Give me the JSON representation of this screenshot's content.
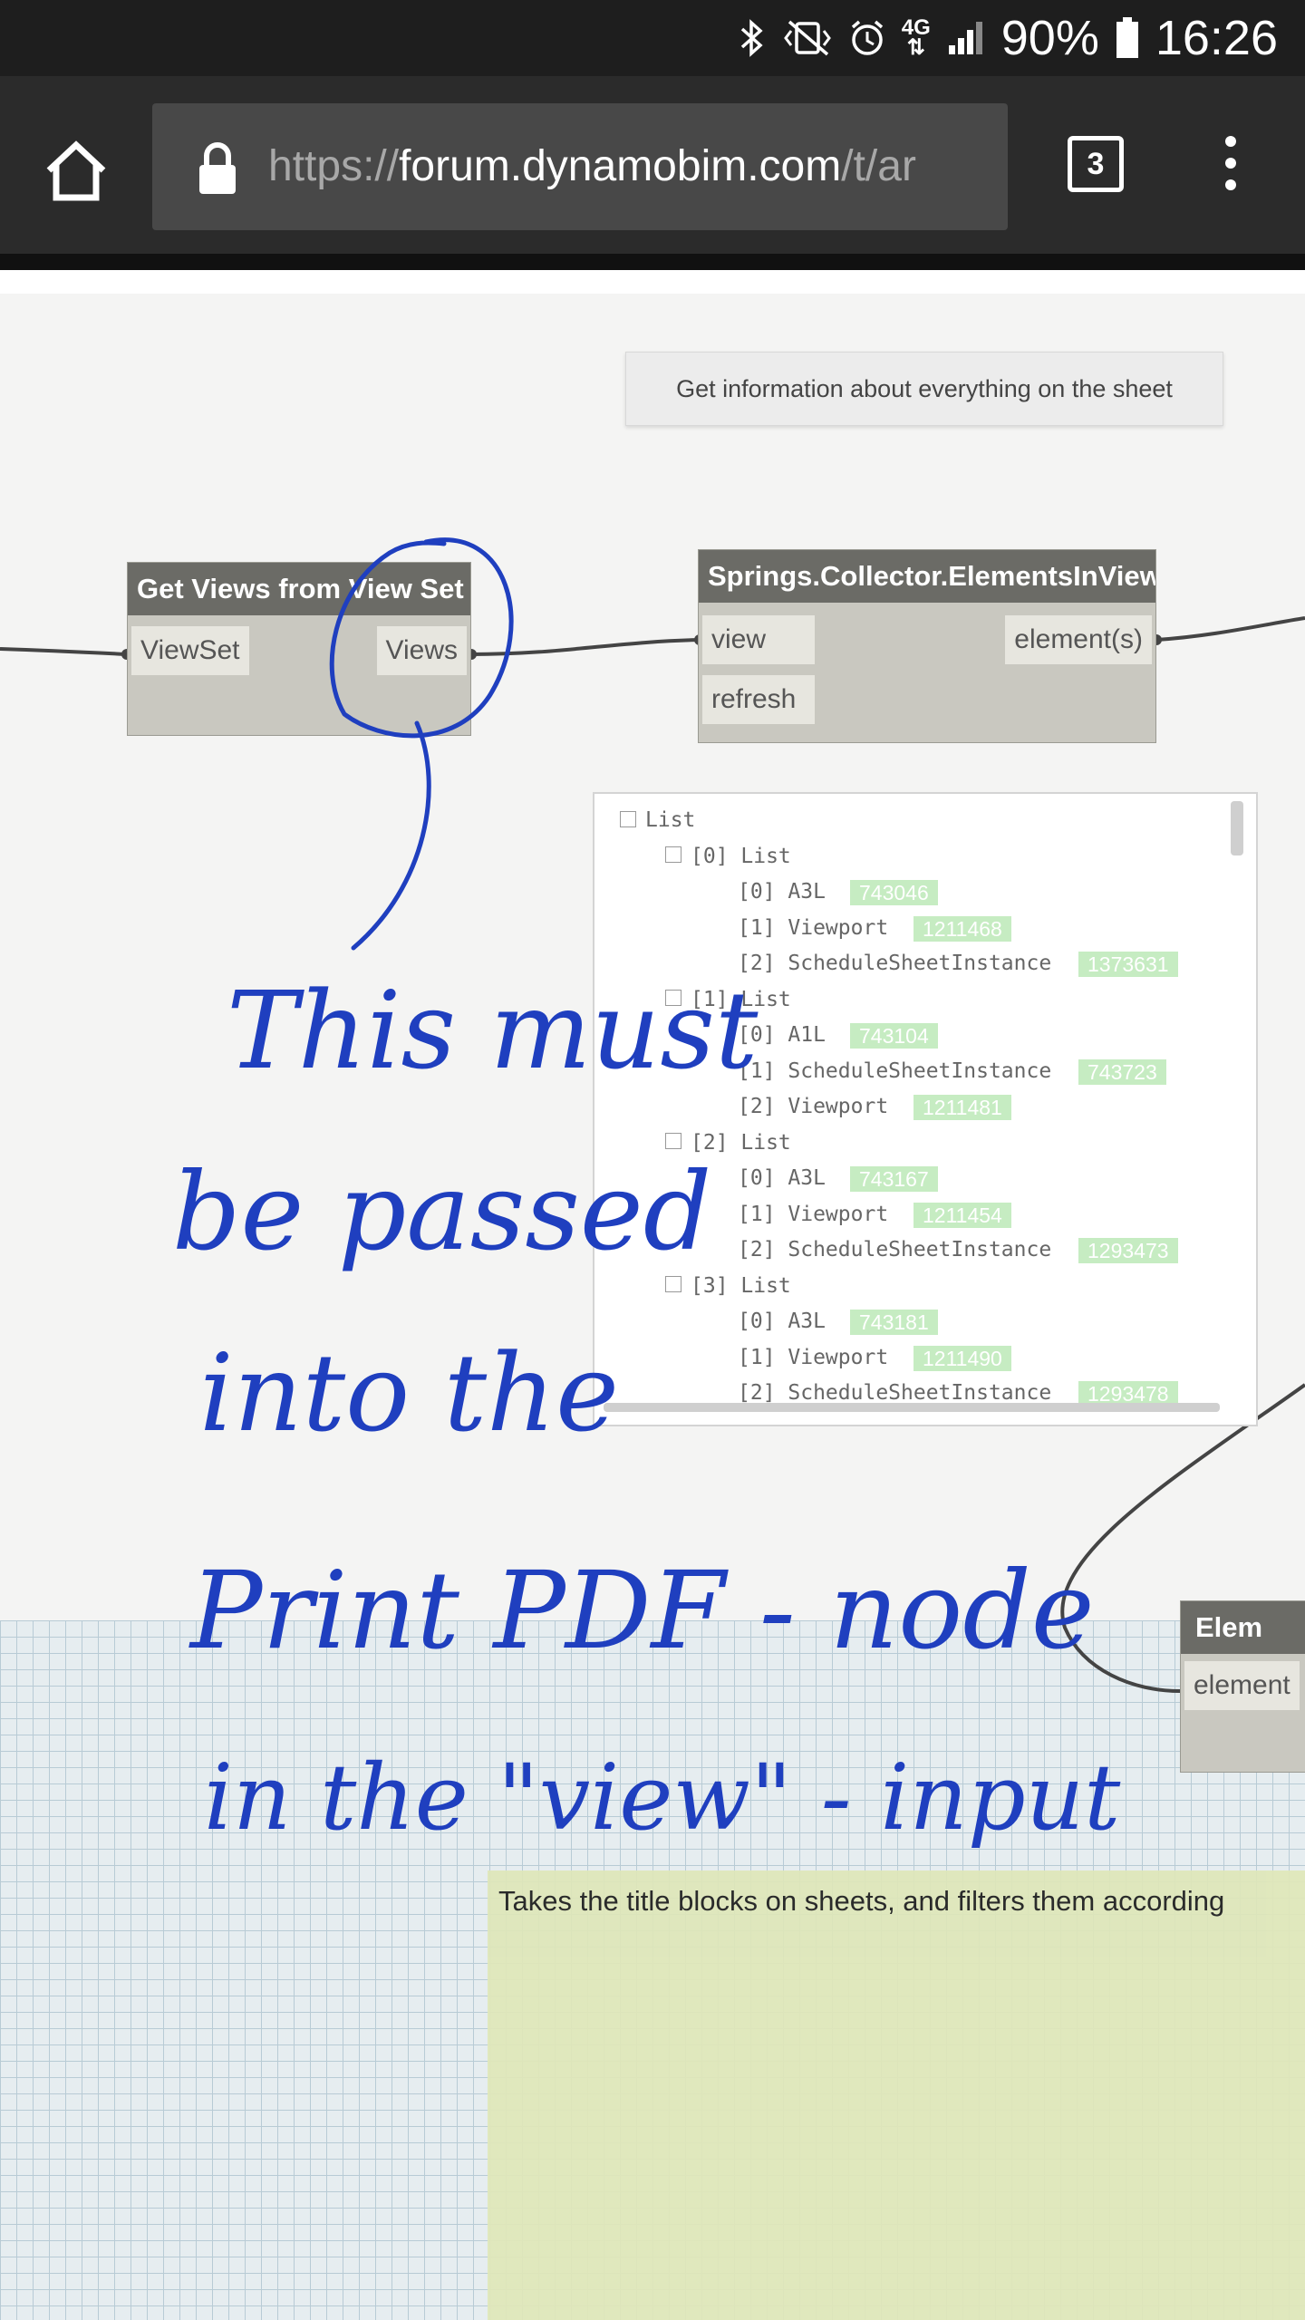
{
  "status_bar": {
    "network_label": "4G",
    "battery": "90%",
    "time": "16:26",
    "icons": [
      "bluetooth-icon",
      "vibrate-mute-icon",
      "alarm-icon",
      "network-type-icon",
      "signal-icon",
      "battery-icon"
    ]
  },
  "browser": {
    "url_prefix": "https://",
    "url_host": "forum.dynamobim.com",
    "url_path": "/t/ar",
    "tab_count": "3",
    "icons": [
      "home-icon",
      "lock-icon",
      "tabs-icon",
      "overflow-menu-icon"
    ]
  },
  "canvas": {
    "top_note": "Get information about everything on the sheet",
    "node_get_views": {
      "title": "Get Views from View Set",
      "input": "ViewSet",
      "output": "Views"
    },
    "node_collector": {
      "title": "Springs.Collector.ElementsInView",
      "inputs": [
        "view",
        "refresh"
      ],
      "output": "element(s)"
    },
    "node_element": {
      "title": "Elem",
      "input": "element"
    },
    "preview": {
      "rows": [
        {
          "indent": 0,
          "expander": true,
          "text": "List",
          "value": ""
        },
        {
          "indent": 1,
          "expander": true,
          "text": "[0] List",
          "value": ""
        },
        {
          "indent": 2,
          "expander": false,
          "text": "[0] A3L",
          "value": "743046"
        },
        {
          "indent": 2,
          "expander": false,
          "text": "[1] Viewport",
          "value": "1211468"
        },
        {
          "indent": 2,
          "expander": false,
          "text": "[2] ScheduleSheetInstance",
          "value": "1373631"
        },
        {
          "indent": 1,
          "expander": true,
          "text": "[1] List",
          "value": ""
        },
        {
          "indent": 2,
          "expander": false,
          "text": "[0] A1L",
          "value": "743104"
        },
        {
          "indent": 2,
          "expander": false,
          "text": "[1] ScheduleSheetInstance",
          "value": "743723"
        },
        {
          "indent": 2,
          "expander": false,
          "text": "[2] Viewport",
          "value": "1211481"
        },
        {
          "indent": 1,
          "expander": true,
          "text": "[2] List",
          "value": ""
        },
        {
          "indent": 2,
          "expander": false,
          "text": "[0] A3L",
          "value": "743167"
        },
        {
          "indent": 2,
          "expander": false,
          "text": "[1] Viewport",
          "value": "1211454"
        },
        {
          "indent": 2,
          "expander": false,
          "text": "[2] ScheduleSheetInstance",
          "value": "1293473"
        },
        {
          "indent": 1,
          "expander": true,
          "text": "[3] List",
          "value": ""
        },
        {
          "indent": 2,
          "expander": false,
          "text": "[0] A3L",
          "value": "743181"
        },
        {
          "indent": 2,
          "expander": false,
          "text": "[1] Viewport",
          "value": "1211490"
        },
        {
          "indent": 2,
          "expander": false,
          "text": "[2] ScheduleSheetInstance",
          "value": "1293478"
        }
      ]
    },
    "bottom_note": "Takes the title blocks on sheets, and filters them according",
    "handwritten_annotation": [
      "This must",
      "be passed",
      "into the",
      "Print PDF - node",
      "in the \"view\" - input"
    ],
    "colors": {
      "node_header": "#6b6b66",
      "node_body": "#c9c8c0",
      "value_badge": "#c6ecc2",
      "ink": "#1f3fbf",
      "note_green": "#dfe7b9"
    }
  }
}
